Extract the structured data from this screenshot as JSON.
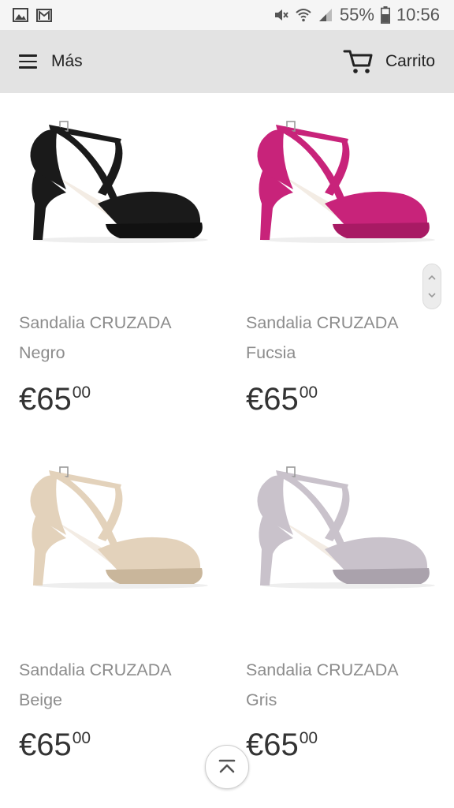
{
  "status_bar": {
    "battery": "55%",
    "time": "10:56",
    "icons": [
      "image-icon",
      "gmail-icon",
      "mute-icon",
      "wifi-icon",
      "signal-icon",
      "battery-icon"
    ]
  },
  "header": {
    "menu_label": "Más",
    "cart_label": "Carrito"
  },
  "products": [
    {
      "name": "Sandalia CRUZADA",
      "color": "Negro",
      "price_main": "€65",
      "price_cents": "00",
      "shoe_color": "#1a1a1a",
      "sole_color": "#111111"
    },
    {
      "name": "Sandalia CRUZADA",
      "color": "Fucsia",
      "price_main": "€65",
      "price_cents": "00",
      "shoe_color": "#c8237a",
      "sole_color": "#a81a64"
    },
    {
      "name": "Sandalia CRUZADA",
      "color": "Beige",
      "price_main": "€65",
      "price_cents": "00",
      "shoe_color": "#e3d2bb",
      "sole_color": "#c9b69b"
    },
    {
      "name": "Sandalia CRUZADA",
      "color": "Gris",
      "price_main": "€65",
      "price_cents": "00",
      "shoe_color": "#c9c2cb",
      "sole_color": "#aaa2ac"
    }
  ]
}
